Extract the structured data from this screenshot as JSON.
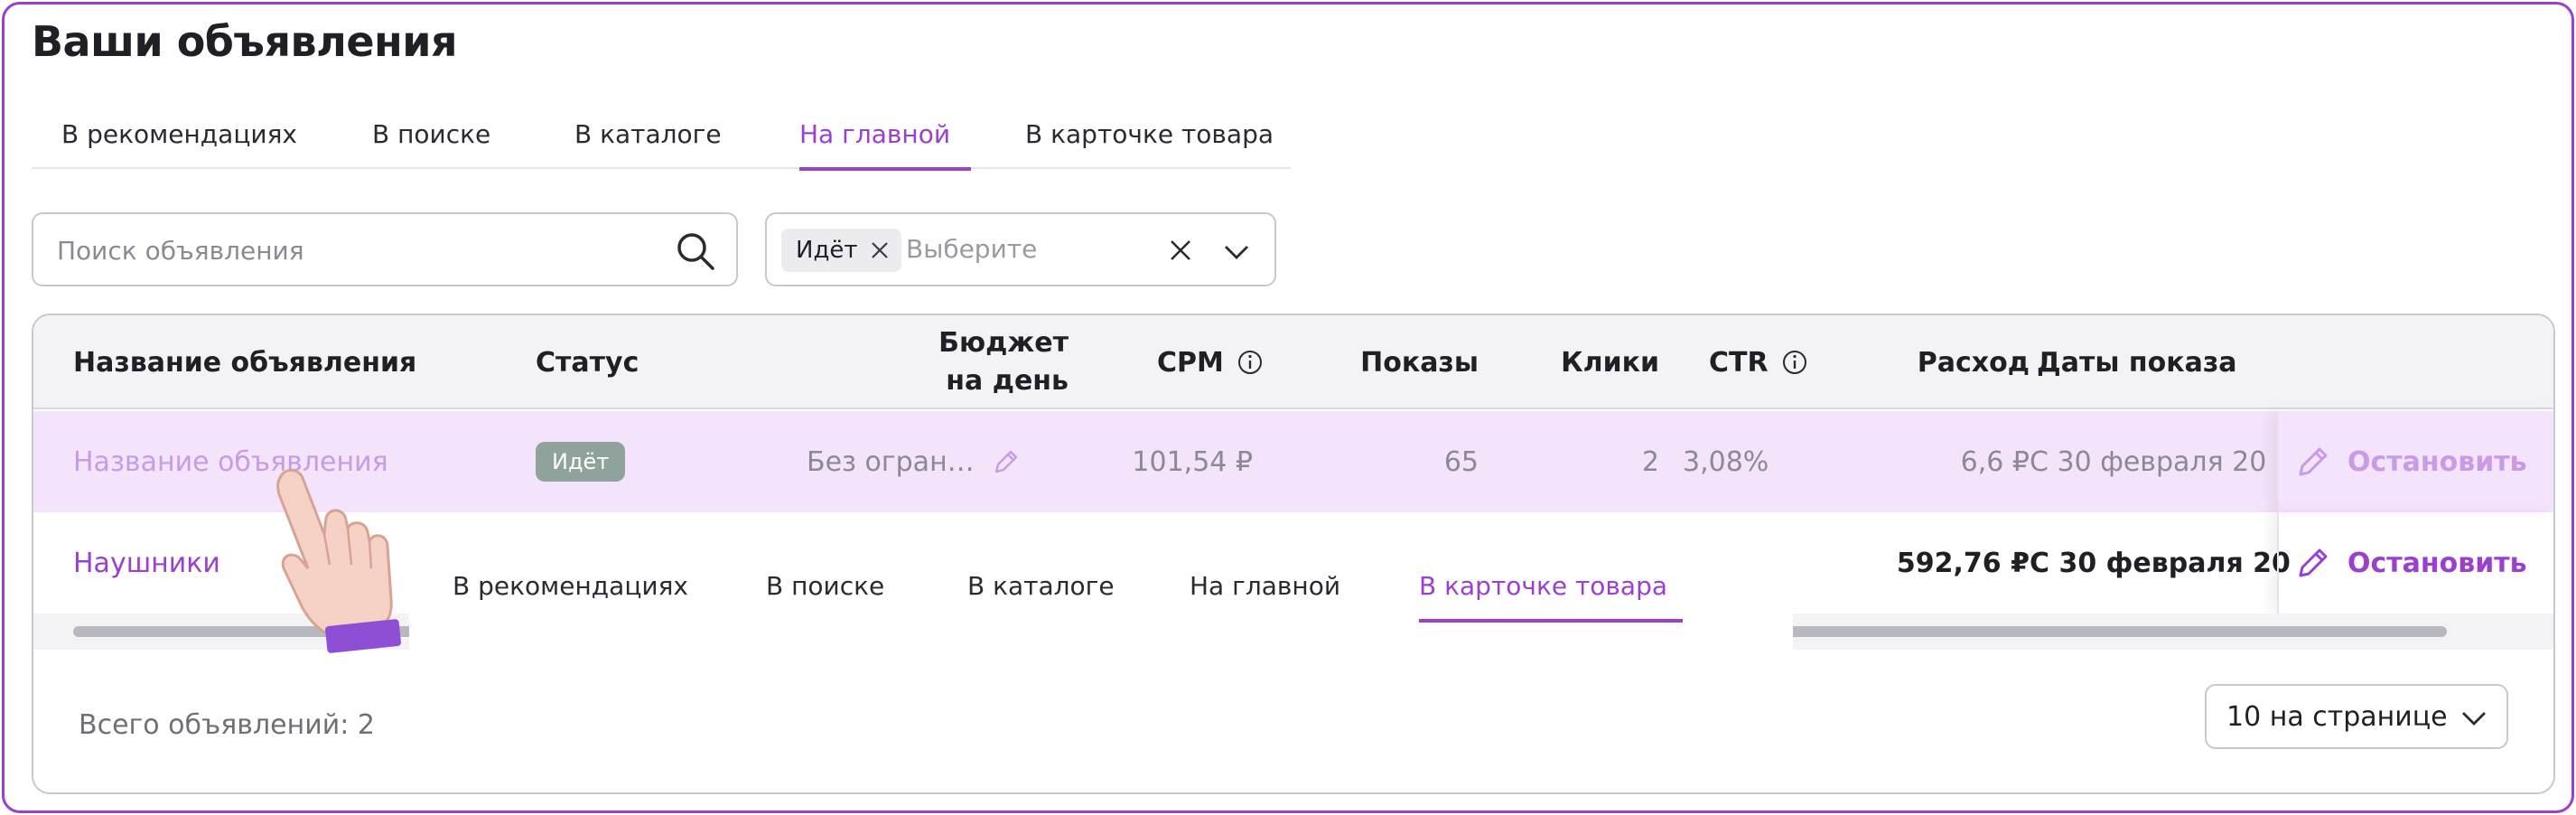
{
  "page": {
    "title": "Ваши объявления"
  },
  "tabs": [
    {
      "label": "В рекомендациях",
      "active": false
    },
    {
      "label": "В поиске",
      "active": false
    },
    {
      "label": "В каталоге",
      "active": false
    },
    {
      "label": "На главной",
      "active": true
    },
    {
      "label": "В карточке товара",
      "active": false
    }
  ],
  "overlay_tabs": [
    {
      "label": "В рекомендациях",
      "active": false
    },
    {
      "label": "В поиске",
      "active": false
    },
    {
      "label": "В каталоге",
      "active": false
    },
    {
      "label": "На главной",
      "active": false
    },
    {
      "label": "В карточке товара",
      "active": true
    }
  ],
  "search": {
    "placeholder": "Поиск объявления",
    "value": ""
  },
  "filter": {
    "chip": "Идёт",
    "placeholder": "Выберите"
  },
  "table": {
    "columns": {
      "name": "Название объявления",
      "status": "Статус",
      "budget_line1": "Бюджет",
      "budget_line2": "на день",
      "cpm": "CPM",
      "shows": "Показы",
      "clicks": "Клики",
      "ctr": "CTR",
      "spend": "Расход",
      "dates": "Даты показа"
    },
    "rows": [
      {
        "name": "Название объявления",
        "status": "Идёт",
        "budget": "Без огран…",
        "cpm": "101,54 ₽",
        "shows": "65",
        "clicks": "2",
        "ctr": "3,08%",
        "spend": "6,6 ₽",
        "dates": "С 30 февраля 20",
        "action": "Остановить"
      },
      {
        "name": "Наушники",
        "spend": "592,76 ₽",
        "dates": "С 30 февраля 20",
        "action": "Остановить"
      }
    ]
  },
  "footer": {
    "total": "Всего объявлений: 2",
    "page_size": "10 на странице"
  },
  "colors": {
    "accent": "#9b3fcf",
    "highlight_row": "#f3e3fb",
    "status_badge": "#8fa39c"
  },
  "icons": [
    "search-icon",
    "close-icon",
    "chevron-down-icon",
    "info-icon",
    "pencil-icon",
    "pointing-hand-icon"
  ]
}
